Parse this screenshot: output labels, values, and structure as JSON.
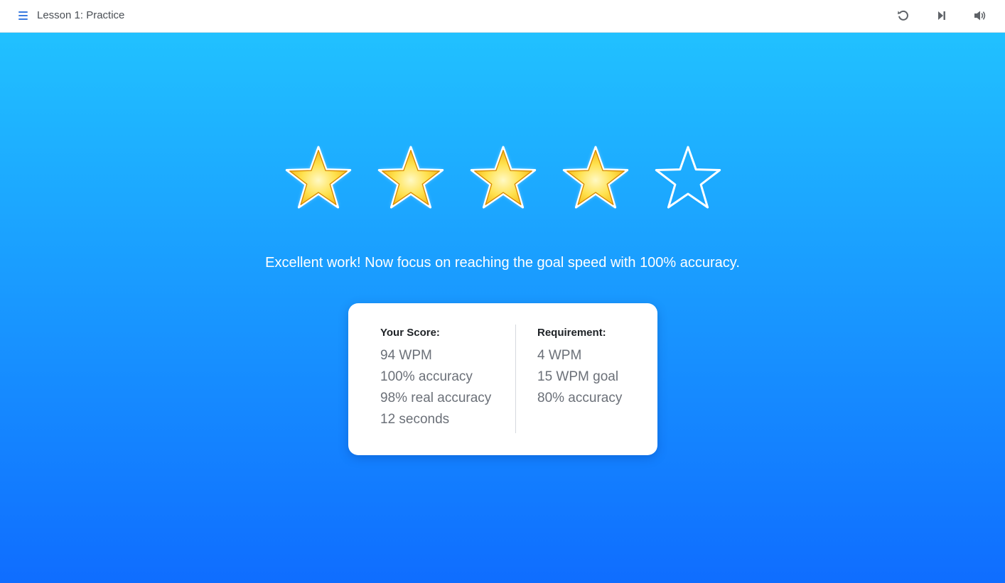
{
  "header": {
    "title": "Lesson 1: Practice",
    "menu_icon": "hamburger-menu-icon",
    "actions": [
      {
        "icon": "restart-icon",
        "name": "restart"
      },
      {
        "icon": "skip-next-icon",
        "name": "skip"
      },
      {
        "icon": "volume-icon",
        "name": "sound"
      }
    ]
  },
  "result": {
    "rating": 4,
    "max_rating": 5,
    "message": "Excellent work! Now focus on reaching the goal speed with 100% accuracy."
  },
  "score": {
    "title": "Your Score:",
    "items": [
      "94 WPM",
      "100% accuracy",
      "98% real accuracy",
      "12 seconds"
    ]
  },
  "requirement": {
    "title": "Requirement:",
    "items": [
      "4 WPM",
      "15 WPM goal",
      "80% accuracy"
    ]
  },
  "colors": {
    "accent": "#3b7be0",
    "background_top": "#21c1ff",
    "background_bottom": "#0f6dff",
    "star_gold": "#f2c200",
    "card_bg": "#ffffff"
  }
}
